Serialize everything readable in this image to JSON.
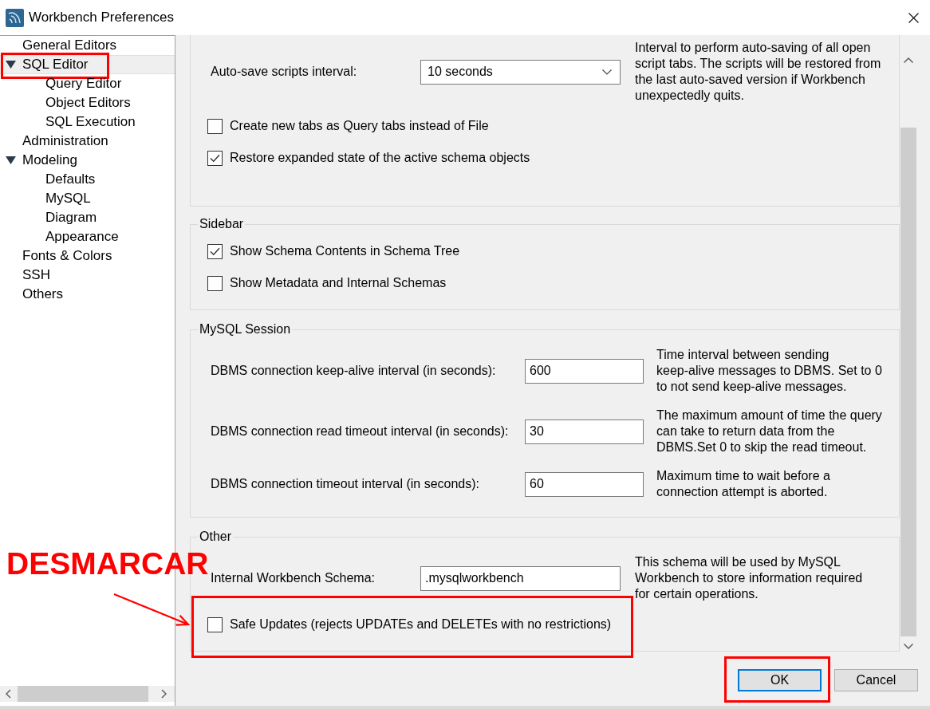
{
  "window": {
    "title": "Workbench Preferences"
  },
  "sidebar": {
    "items": [
      {
        "label": "General Editors",
        "selected": false,
        "highlighted": false
      },
      {
        "label": "SQL Editor",
        "selected": true,
        "highlighted": true,
        "expanded": true,
        "children": [
          {
            "label": "Query Editor",
            "selected": false,
            "highlighted": false
          },
          {
            "label": "Object Editors",
            "selected": false,
            "highlighted": false
          },
          {
            "label": "SQL Execution",
            "selected": false,
            "highlighted": false
          }
        ]
      },
      {
        "label": "Administration",
        "selected": false,
        "highlighted": false
      },
      {
        "label": "Modeling",
        "selected": false,
        "highlighted": false,
        "expanded": true,
        "children": [
          {
            "label": "Defaults",
            "selected": false,
            "highlighted": false
          },
          {
            "label": "MySQL",
            "selected": false,
            "highlighted": false
          },
          {
            "label": "Diagram",
            "selected": false,
            "highlighted": false
          },
          {
            "label": "Appearance",
            "selected": false,
            "highlighted": false
          }
        ]
      },
      {
        "label": "Fonts & Colors",
        "selected": false,
        "highlighted": false
      },
      {
        "label": "SSH",
        "selected": false,
        "highlighted": false
      },
      {
        "label": "Others",
        "selected": false,
        "highlighted": false
      }
    ]
  },
  "sections": [
    {
      "rows": [
        {
          "kind": "dropdown",
          "label": "Auto-save scripts interval:",
          "value": "10 seconds",
          "description": "Interval to perform auto-saving of all open script tabs. The scripts will be restored from the last auto-saved version if Workbench unexpectedly quits.",
          "highlighted": false
        },
        {
          "kind": "checkbox",
          "label": "Create new tabs as Query tabs instead of File",
          "checked": false,
          "highlighted": false
        },
        {
          "kind": "checkbox",
          "label": "Restore expanded state of the active schema objects",
          "checked": true,
          "highlighted": false
        }
      ]
    },
    {
      "title": "Sidebar",
      "rows": [
        {
          "kind": "checkbox",
          "label": "Show Schema Contents in Schema Tree",
          "checked": true,
          "highlighted": false
        },
        {
          "kind": "checkbox",
          "label": "Show Metadata and Internal Schemas",
          "checked": false,
          "highlighted": false
        }
      ]
    },
    {
      "title": "MySQL Session",
      "rows": [
        {
          "kind": "number",
          "label": "DBMS connection keep-alive interval (in seconds):",
          "value": "600",
          "description": "Time interval between sending keep-alive messages to DBMS. Set to 0 to not send keep-alive messages.",
          "highlighted": false
        },
        {
          "kind": "number",
          "label": "DBMS connection read timeout interval (in seconds):",
          "value": "30",
          "description": "The maximum amount of time the query can take to return data from the DBMS.Set 0 to skip the read timeout.",
          "highlighted": false
        },
        {
          "kind": "number",
          "label": "DBMS connection timeout interval (in seconds):",
          "value": "60",
          "description": "Maximum time to wait before a connection attempt is aborted.",
          "highlighted": false
        }
      ]
    },
    {
      "title": "Other",
      "rows": [
        {
          "kind": "text",
          "label": "Internal Workbench Schema:",
          "value": ".mysqlworkbench",
          "description": "This schema will be used by MySQL Workbench to store information required for certain operations.",
          "highlighted": false
        },
        {
          "kind": "checkbox",
          "label": "Safe Updates (rejects UPDATEs and DELETEs with no restrictions)",
          "checked": false,
          "highlighted": true
        }
      ]
    }
  ],
  "buttons": [
    {
      "label": "OK",
      "focused": true,
      "highlighted": true
    },
    {
      "label": "Cancel",
      "focused": false,
      "highlighted": false
    }
  ],
  "annotation": {
    "label": "DESMARCAR"
  }
}
